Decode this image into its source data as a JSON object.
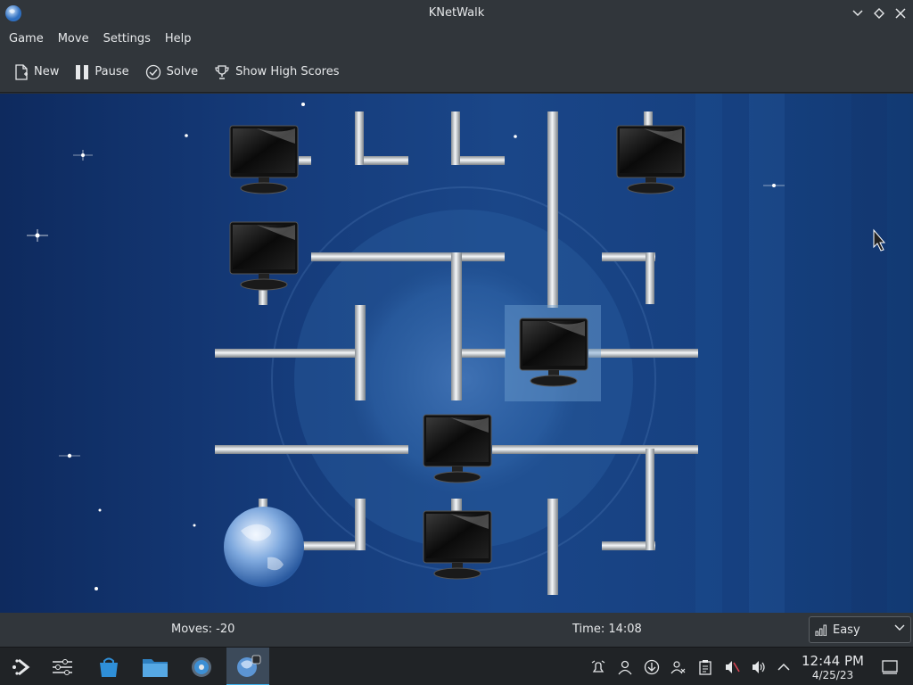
{
  "window": {
    "title": "KNetWalk"
  },
  "menu": [
    "Game",
    "Move",
    "Settings",
    "Help"
  ],
  "toolbar": {
    "new_label": "New",
    "pause_label": "Pause",
    "solve_label": "Solve",
    "highscores_label": "Show High Scores"
  },
  "status": {
    "moves": "Moves: -20",
    "time": "Time: 14:08",
    "difficulty": "Easy"
  },
  "clock": {
    "time": "12:44 PM",
    "date": "4/25/23"
  },
  "colors": {
    "accent": "#3daee9",
    "panel": "#31363b"
  }
}
